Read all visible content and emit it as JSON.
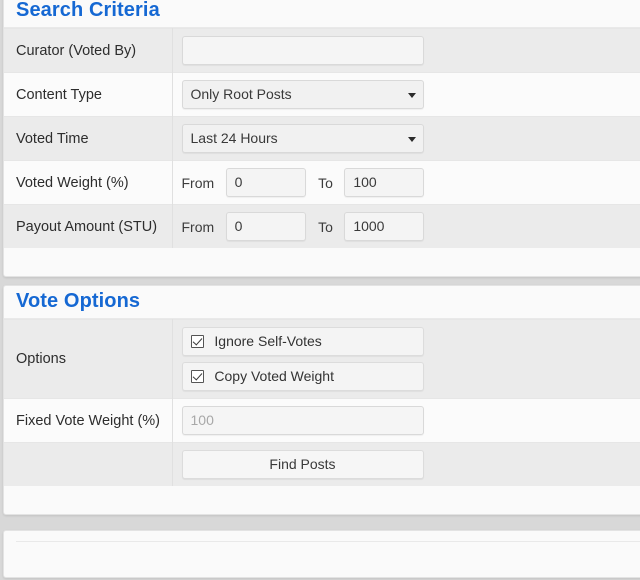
{
  "panels": {
    "search": {
      "title": "Search Criteria",
      "rows": [
        {
          "label": "Curator (Voted By)",
          "type": "text",
          "value": ""
        },
        {
          "label": "Content Type",
          "type": "select",
          "value": "Only Root Posts"
        },
        {
          "label": "Voted Time",
          "type": "select",
          "value": "Last 24 Hours"
        },
        {
          "label": "Voted Weight (%)",
          "type": "range",
          "from_label": "From",
          "from_value": "0",
          "to_label": "To",
          "to_value": "100"
        },
        {
          "label": "Payout Amount (STU)",
          "type": "range",
          "from_label": "From",
          "from_value": "0",
          "to_label": "To",
          "to_value": "1000"
        }
      ]
    },
    "vote": {
      "title": "Vote Options",
      "options_label": "Options",
      "checkboxes": [
        {
          "label": "Ignore Self-Votes",
          "checked": true
        },
        {
          "label": "Copy Voted Weight",
          "checked": true
        }
      ],
      "fixed_weight_label": "Fixed Vote Weight (%)",
      "fixed_weight_placeholder": "100",
      "fixed_weight_value": "",
      "submit_label": "Find Posts"
    },
    "results": {
      "title": ""
    }
  },
  "colors": {
    "heading_blue": "#1568d3",
    "row_gray": "#ebebeb",
    "row_white": "#fbfbfb",
    "panel_bg": "#fafafa",
    "page_bg": "#d8d8d8"
  },
  "icons": {
    "dropdown": "chevron-down-icon",
    "checkbox_checked": "checkbox-checked-icon"
  }
}
